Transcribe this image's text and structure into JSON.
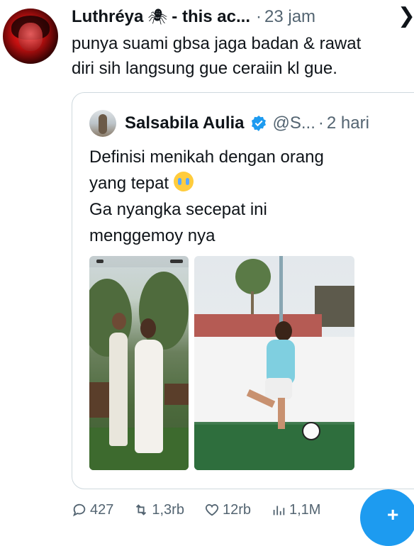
{
  "tweet": {
    "author_name": "Luthréya",
    "author_suffix": "- this ac...",
    "separator": "·",
    "time": "23 jam",
    "text_line1": "punya suami gbsa jaga badan & rawat",
    "text_line2": "diri sih langsung gue ceraiin kl gue."
  },
  "quote": {
    "author_name": "Salsabila Aulia",
    "handle": "@S...",
    "separator": "·",
    "time": "2 hari",
    "line1": "Definisi menikah dengan orang",
    "line2": "yang tepat",
    "line3": "Ga nyangka secepat ini",
    "line4": "menggemoy nya"
  },
  "actions": {
    "replies": "427",
    "retweets": "1,3rb",
    "likes": "12rb",
    "views": "1,1M"
  },
  "colors": {
    "accent": "#1d9bf0",
    "muted": "#536471",
    "border": "#cfd9de"
  },
  "icons": {
    "more": "more-chevron-icon",
    "verified": "verified-badge-icon",
    "reply": "reply-icon",
    "retweet": "retweet-icon",
    "like": "heart-icon",
    "views": "views-icon",
    "compose": "compose-plus-icon"
  }
}
